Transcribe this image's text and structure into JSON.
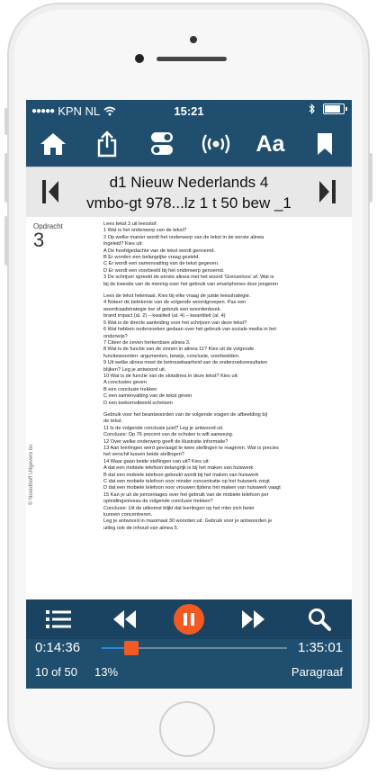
{
  "status": {
    "carrier": "KPN NL",
    "time": "15:21"
  },
  "toolbar": {
    "font_label": "Aa"
  },
  "book": {
    "title_line1": "d1 Nieuw Nederlands 4",
    "title_line2": "vmbo-gt 978...lz 1 t 50 bew _1"
  },
  "page": {
    "marker": "Opdracht",
    "number": "3",
    "side_note": "© Noordhoff Uitgevers bv",
    "lines": [
      "Lees tekst 3 uit leesstof.",
      "1  Wat is het onderwerp van de tekst?",
      "2  Op welke manier wordt het onderwerp van de tekst in de eerste alinea",
      "    ingeleid? Kies uit:",
      "    A  De hoofdgedachte van de tekst wordt genoemd.",
      "    B  Er worden een belangrijke vraag gesteld.",
      "    C  Er wordt een samenvatting van de tekst gegeven.",
      "    D  Er wordt een voorbeeld bij het onderwerp genoemd.",
      "3  De schrijver spreekt de eerste alinea met het woord 'Grenzeloos' af. Wat is",
      "    bij de kwestie van de mening over het gebruik van smartphones door jongeren",
      "",
      "Lees de tekst helemaal. Kies bij elke vraag de juiste leesstrategie.",
      "4  Noteer de betekenis van de volgende woordgroepen. Pas een",
      "    woordraadstrategie toe of gebruik een woordenboek.",
      "    brand impact (al. 2) – kwaliteit (al. 4) – kwantiteit (al. 4)",
      "5  Wat is de directe aanleiding voor het schrijven van deze tekst?",
      "6  Wat hebben onderzoeken gedaan over het gebruik van sociale media in het",
      "    onderwijs?",
      "7  Citeer de zeven herkenbare alinea 3.",
      "8  Wat is de functie van de zinnen in alinea 11? Kies uit de volgende",
      "    functiewoorden: argumenten, bewijs, conclusie, voorbeelden.",
      "9  Uit welke alinea moet de betrouwbaarheid van de onderzoeksresultaten",
      "    blijken? Leg je antwoord uit.",
      "10 Wat is de functie van de slotalinea in deze tekst? Kies uit:",
      "    A  conclusies geven",
      "    B  een conclusie trekken",
      "    C  een samenvatting van de tekst geven",
      "    D  een toekomstbeeld schetsen",
      "",
      "Gebruik voor het beantwoorden van de volgende vragen de afbeelding bij",
      "de tekst.",
      "11 Is de volgende conclusie juist? Leg je antwoord uit.",
      "    Conclusie: Op 76 procent van de scholen is wifi aanwezig.",
      "12 Over welke onderwerp geeft de illustratie informatie?",
      "13 Aan leerlingen werd gevraagd te twee stellingen te reageren. Wat is precies",
      "    het verschil tussen beide stellingen?",
      "14 Waar gaan beide stellingen van uit? Kies uit:",
      "    A  dat een mobiele telefoon belangrijk is bij het maken van huiswerk",
      "    B  dat een mobiele telefoon gebruikt wordt bij het maken van huiswerk",
      "    C  dat een mobiele telefoon voor minder concentratie op het huiswerk zorgt",
      "    D  dat een mobiele telefoon voor vrouwen tijdens het maken van huiswerk vaagt",
      "15 Kan je uit de percentages over het gebruik van de mobiele telefoon per",
      "    opleidingsniveau de volgende conclusie trekken?",
      "    Conclusie: Uit de uitkomst blijkt dat leerlingen op het mbo zich beter",
      "    kunnen concentreren.",
      "    Leg je antwoord in maximaal 30 woorden uit. Gebruik voor je antwoorden je",
      "    uitleg ook de inhoud van alinea 5."
    ]
  },
  "player": {
    "elapsed": "0:14:36",
    "total": "1:35:01",
    "progress": 0.16,
    "page_count": "10 of 50",
    "percent": "13%",
    "mode": "Paragraaf"
  },
  "colors": {
    "screen_bg": "#1f4e6e",
    "accent": "#f25a22",
    "track": "#2a8bdc"
  }
}
